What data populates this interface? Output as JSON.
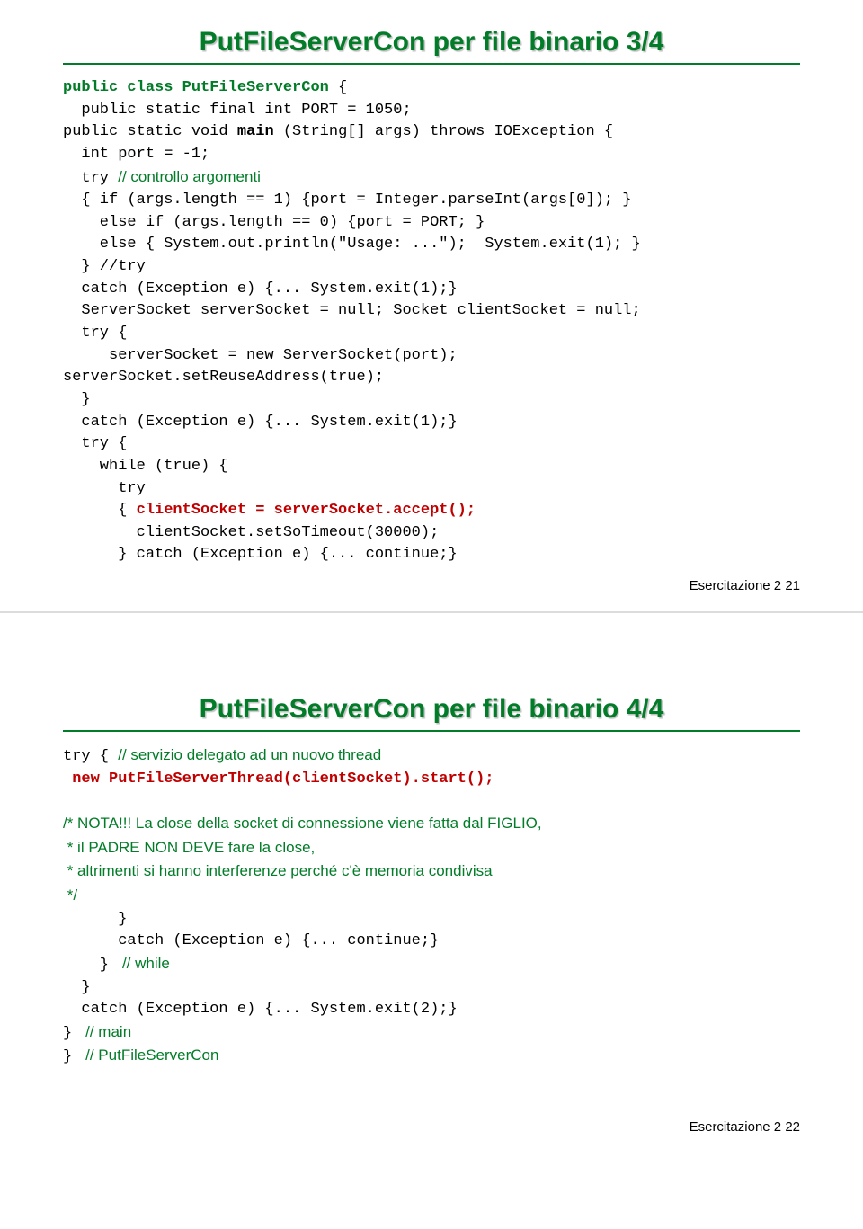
{
  "slide1": {
    "title": "PutFileServerCon per file binario 3/4",
    "line1a": "public class PutFileServerCon",
    "line1b": " {",
    "line2": "  public static final int PORT = 1050;",
    "line3a": "public static void ",
    "line3b": "main",
    "line3c": " (String[] args) throws IOException {",
    "line4": "  int port = -1;",
    "line5a": "  try ",
    "line5b": "// controllo argomenti",
    "line6": "  { if (args.length == 1) {port = Integer.parseInt(args[0]); }",
    "line7": "    else if (args.length == 0) {port = PORT; }",
    "line8": "    else { System.out.println(\"Usage: ...\");  System.exit(1); }",
    "line9": "  } //try",
    "line10": "  catch (Exception e) {... System.exit(1);}",
    "line11": "  ServerSocket serverSocket = null; Socket clientSocket = null;",
    "line12": "  try {",
    "line13": "     serverSocket = new ServerSocket(port);",
    "line14": "serverSocket.setReuseAddress(true);",
    "line15": "  }",
    "line16": "  catch (Exception e) {... System.exit(1);}",
    "line17": "  try {",
    "line18": "    while (true) {",
    "line19": "      try",
    "line20a": "      { ",
    "line20b": "clientSocket = serverSocket.accept();",
    "line21": "        clientSocket.setSoTimeout(30000);",
    "line22": "      } catch (Exception e) {... continue;}",
    "footer": "Esercitazione 2   21"
  },
  "slide2": {
    "title": "PutFileServerCon per file binario 4/4",
    "line1a": "try { ",
    "line1b": "// servizio delegato ad un nuovo thread",
    "line2": " new PutFileServerThread(clientSocket).start();",
    "line3": "/* NOTA!!! La close della socket di connessione viene fatta dal FIGLIO,",
    "line4": " * il PADRE NON DEVE fare la close,",
    "line5": " * altrimenti si hanno interferenze perché c'è memoria condivisa",
    "line6": " */",
    "line7": "      }",
    "line8": "      catch (Exception e) {... continue;}",
    "line9a": "    } ",
    "line9b": " // while",
    "line10": "  }",
    "line11": "  catch (Exception e) {... System.exit(2);}",
    "line12a": "} ",
    "line12b": " // main",
    "line13a": "} ",
    "line13b": " // PutFileServerCon",
    "footer": "Esercitazione 2   22"
  }
}
